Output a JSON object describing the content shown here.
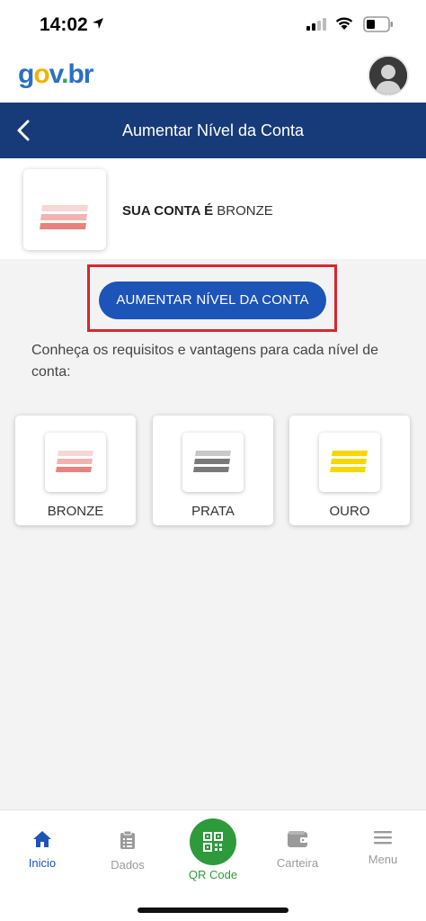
{
  "status_bar": {
    "time": "14:02"
  },
  "header": {
    "logo": {
      "g": "g",
      "o": "o",
      "v": "v",
      "dot": ".",
      "br": "br"
    }
  },
  "title_bar": {
    "title": "Aumentar Nível da Conta"
  },
  "account": {
    "level_prefix": "SUA CONTA É",
    "level_value": "BRONZE"
  },
  "actions": {
    "increase_label": "AUMENTAR NÍVEL DA CONTA"
  },
  "info": {
    "text": "Conheça os requisitos e vantagens para cada nível de conta:"
  },
  "levels": [
    {
      "label": "BRONZE",
      "colors": [
        "#f7d7d5",
        "#f2b4b1",
        "#e9827d"
      ]
    },
    {
      "label": "PRATA",
      "colors": [
        "#c9c9c9",
        "#7a7a7a",
        "#7a7a7a"
      ]
    },
    {
      "label": "OURO",
      "colors": [
        "#f7d700",
        "#f7d700",
        "#f7d700"
      ]
    }
  ],
  "bottom_nav": {
    "items": [
      {
        "label": "Inicio",
        "icon": "home-icon",
        "active": true
      },
      {
        "label": "Dados",
        "icon": "clipboard-icon",
        "active": false
      },
      {
        "label": "QR Code",
        "icon": "qr-code-icon",
        "active": false
      },
      {
        "label": "Carteira",
        "icon": "wallet-icon",
        "active": false
      },
      {
        "label": "Menu",
        "icon": "menu-icon",
        "active": false
      }
    ]
  },
  "colors": {
    "primary": "#1d54b8",
    "title_bar": "#173b78",
    "highlight": "#d9262d",
    "qr_green": "#2d9a3c"
  }
}
